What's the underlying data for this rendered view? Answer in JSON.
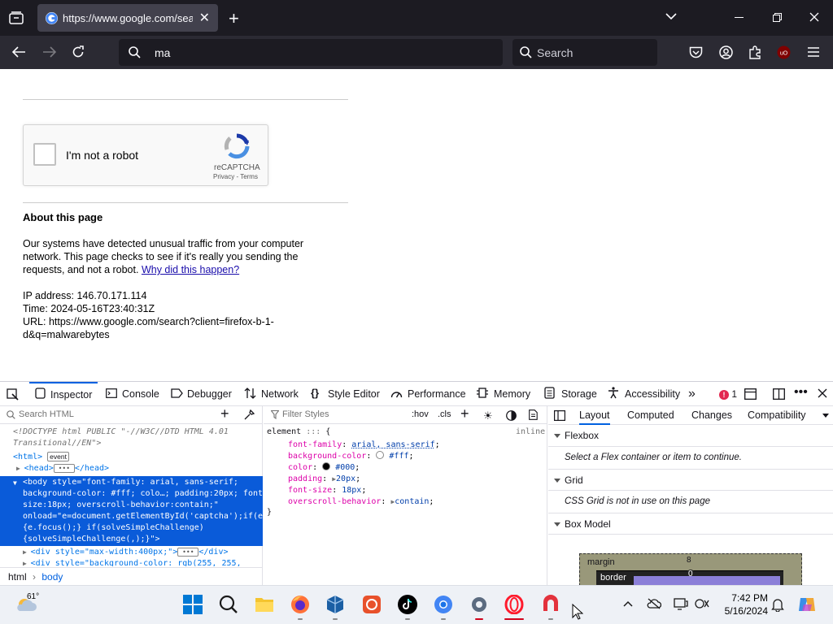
{
  "browser": {
    "tab_title": "https://www.google.com/search?",
    "address_value": "ma",
    "search_placeholder": "Search"
  },
  "captcha": {
    "label": "I'm not a robot",
    "brand": "reCAPTCHA",
    "links": "Privacy - Terms"
  },
  "page": {
    "about_title": "About this page",
    "about_text": "Our systems have detected unusual traffic from your computer network. This page checks to see if it's really you sending the requests, and not a robot. ",
    "about_link": "Why did this happen?",
    "ip": "IP address: 146.70.171.114",
    "time": "Time: 2024-05-16T23:40:31Z",
    "url": "URL: https://www.google.com/search?client=firefox-b-1-d&q=malwarebytes"
  },
  "devtools": {
    "tabs": [
      "Inspector",
      "Console",
      "Debugger",
      "Network",
      "Style Editor",
      "Performance",
      "Memory",
      "Storage",
      "Accessibility"
    ],
    "error_count": "1",
    "search_html_placeholder": "Search HTML",
    "filter_styles_placeholder": "Filter Styles",
    "hov": ":hov",
    "cls": ".cls",
    "doctype": "<!DOCTYPE html PUBLIC \"-//W3C//DTD HTML 4.01",
    "doctype2": "Transitional//EN\">",
    "html_tag": "<html>",
    "event_badge": "event",
    "head_line": "<head>",
    "body_line": "<body style=\"font-family: arial, sans-serif;\nbackground-color: #fff; colo…; padding:20px; font-\nsize:18px; overscroll-behavior:contain;\"\nonload=\"e=document.getElementById('captcha');if(e)\n{e.focus();} if(solveSimpleChallenge)\n{solveSimpleChallenge(,);}\">",
    "div_line": "<div style=\"max-width:400px;\">",
    "div2_line": "<div style=\"background-color: rgb(255, 255,",
    "breadcrumb_html": "html",
    "breadcrumb_body": "body",
    "rule_selector": "element",
    "rule_inline": "inline",
    "rules": [
      {
        "name": "font-family",
        "value": "arial, sans-serif"
      },
      {
        "name": "background-color",
        "value": "#fff"
      },
      {
        "name": "color",
        "value": "#000"
      },
      {
        "name": "padding",
        "value": "20px"
      },
      {
        "name": "font-size",
        "value": "18px"
      },
      {
        "name": "overscroll-behavior",
        "value": "contain"
      }
    ],
    "layout_tabs": [
      "Layout",
      "Computed",
      "Changes",
      "Compatibility"
    ],
    "flexbox_title": "Flexbox",
    "flexbox_note": "Select a Flex container or item to continue.",
    "grid_title": "Grid",
    "grid_note": "CSS Grid is not in use on this page",
    "boxmodel_title": "Box Model",
    "bm_margin": "margin",
    "bm_margin_val": "8",
    "bm_border": "border",
    "bm_border_val": "0"
  },
  "taskbar": {
    "weather_temp": "61°",
    "time": "7:42 PM",
    "date": "5/16/2024"
  },
  "colors": {
    "accent": "#0061e0",
    "selection": "#0a5bd9",
    "link": "#1a0dab"
  }
}
